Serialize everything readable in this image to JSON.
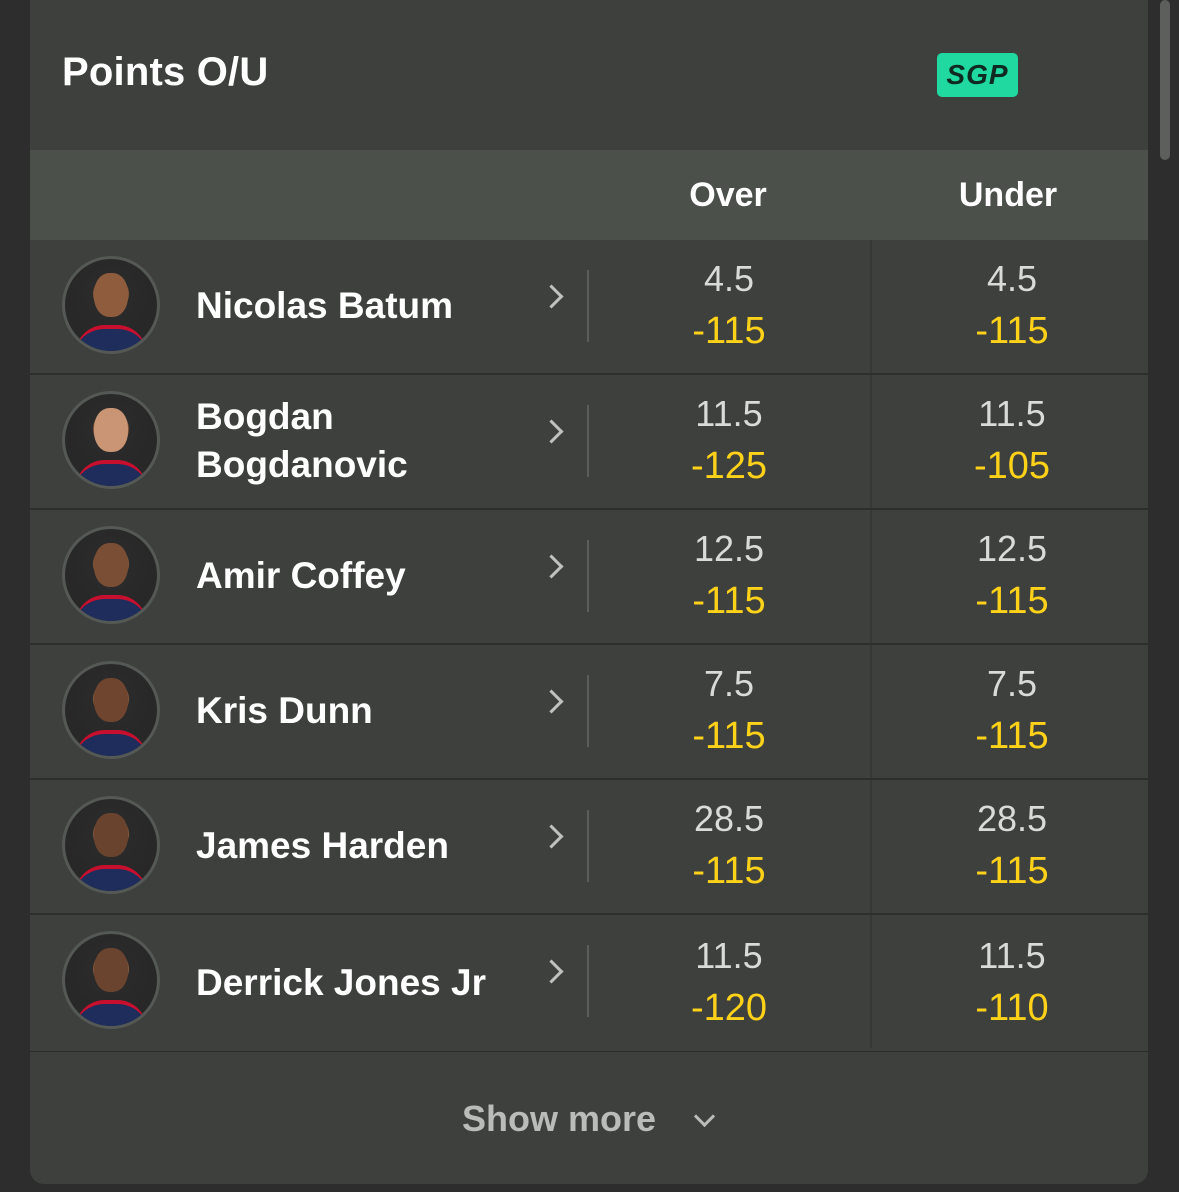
{
  "market": {
    "title": "Points O/U",
    "badge": "SGP"
  },
  "columns": {
    "over": "Over",
    "under": "Under"
  },
  "players": [
    {
      "name": "Nicolas Batum",
      "over_line": "4.5",
      "over_price": "-115",
      "under_line": "4.5",
      "under_price": "-115"
    },
    {
      "name": "Bogdan Bogdanovic",
      "over_line": "11.5",
      "over_price": "-125",
      "under_line": "11.5",
      "under_price": "-105"
    },
    {
      "name": "Amir Coffey",
      "over_line": "12.5",
      "over_price": "-115",
      "under_line": "12.5",
      "under_price": "-115"
    },
    {
      "name": "Kris Dunn",
      "over_line": "7.5",
      "over_price": "-115",
      "under_line": "7.5",
      "under_price": "-115"
    },
    {
      "name": "James Harden",
      "over_line": "28.5",
      "over_price": "-115",
      "under_line": "28.5",
      "under_price": "-115"
    },
    {
      "name": "Derrick Jones Jr",
      "over_line": "11.5",
      "over_price": "-120",
      "under_line": "11.5",
      "under_price": "-110"
    }
  ],
  "footer": {
    "show_more": "Show more"
  },
  "colors": {
    "price": "#ffd21a",
    "badge": "#1fd9a0",
    "card": "#3d403d",
    "header": "#4b504b"
  }
}
